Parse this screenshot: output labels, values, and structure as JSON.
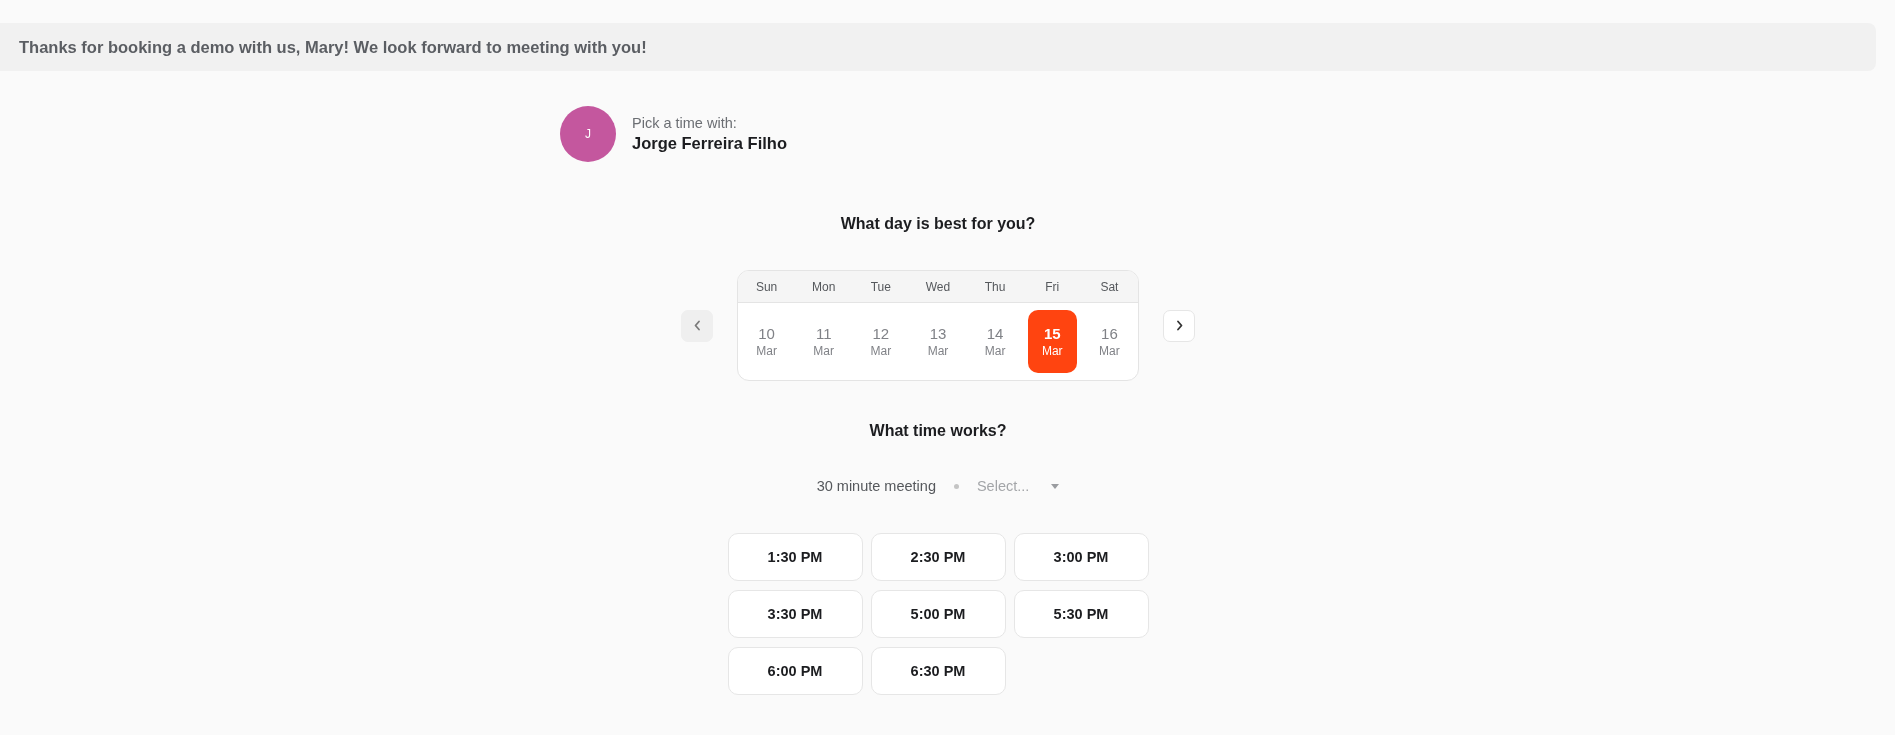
{
  "banner": {
    "text": "Thanks for booking a demo with us, Mary! We look forward to meeting with you!"
  },
  "host": {
    "avatar_initial": "J",
    "color": "#c4579e",
    "caption": "Pick a time with:",
    "name": "Jorge Ferreira Filho"
  },
  "day_heading": "What day is best for you?",
  "calendar": {
    "weekdays": [
      "Sun",
      "Mon",
      "Tue",
      "Wed",
      "Thu",
      "Fri",
      "Sat"
    ],
    "days": [
      {
        "day": "10",
        "month": "Mar",
        "selected": false
      },
      {
        "day": "11",
        "month": "Mar",
        "selected": false
      },
      {
        "day": "12",
        "month": "Mar",
        "selected": false
      },
      {
        "day": "13",
        "month": "Mar",
        "selected": false
      },
      {
        "day": "14",
        "month": "Mar",
        "selected": false
      },
      {
        "day": "15",
        "month": "Mar",
        "selected": true
      },
      {
        "day": "16",
        "month": "Mar",
        "selected": false
      }
    ],
    "prev_disabled": true
  },
  "time_heading": "What time works?",
  "meeting": {
    "duration": "30 minute meeting",
    "select": {
      "placeholder": "Select..."
    }
  },
  "times": [
    "1:30 PM",
    "2:30 PM",
    "3:00 PM",
    "3:30 PM",
    "5:00 PM",
    "5:30 PM",
    "6:00 PM",
    "6:30 PM"
  ]
}
